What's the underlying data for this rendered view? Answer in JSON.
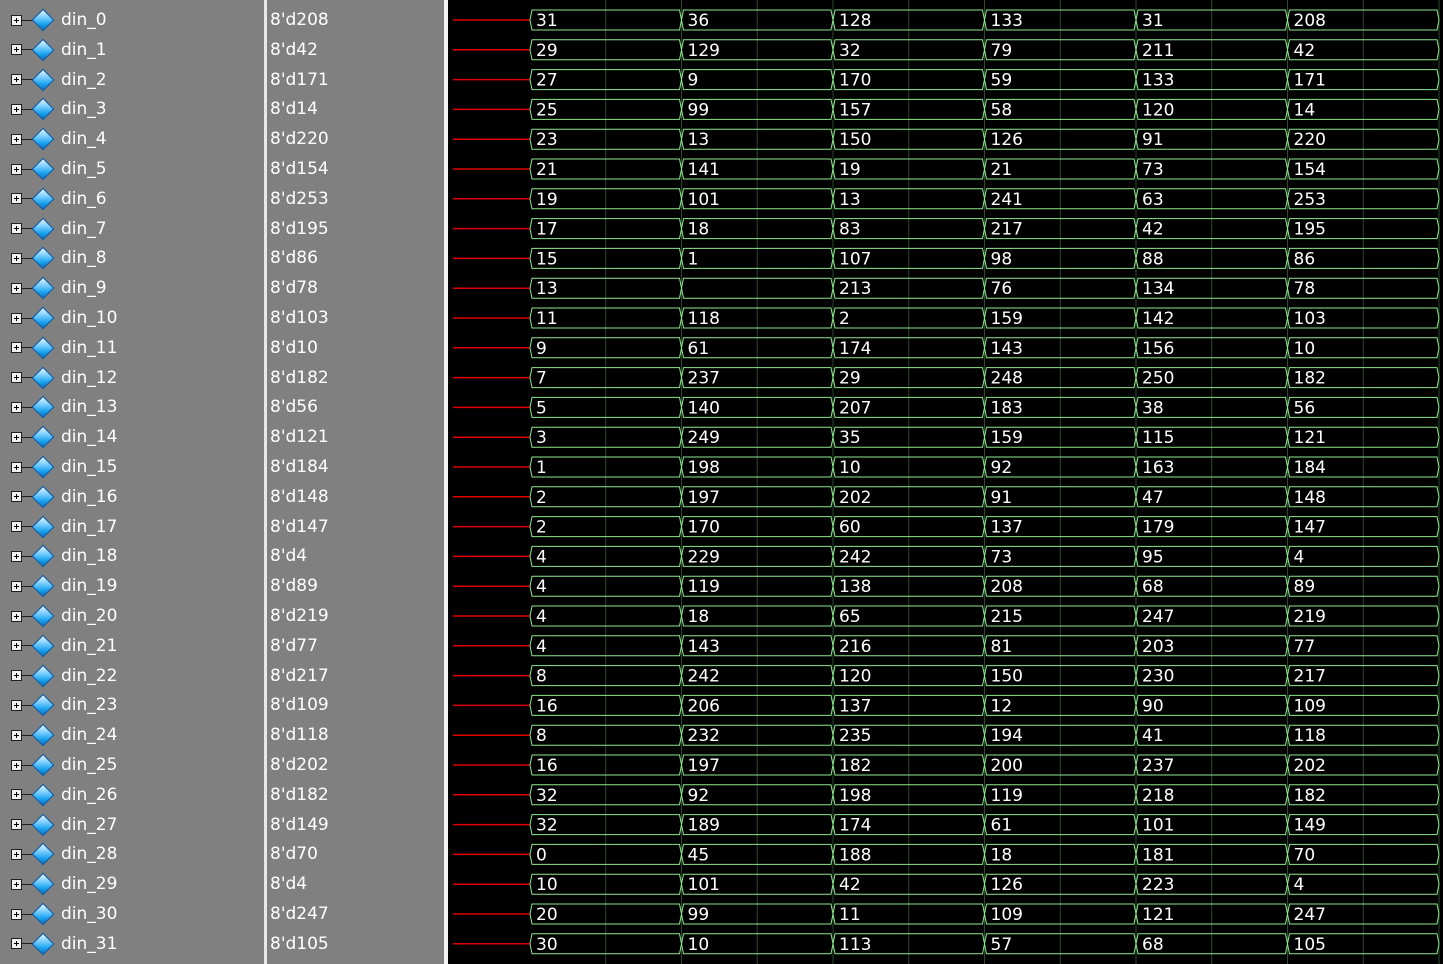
{
  "colors": {
    "pane_background": "#808080",
    "wave_background": "#000000",
    "bus_line": "#8ee88e",
    "undefined_line": "#e00000",
    "text": "#ffffff"
  },
  "icons": {
    "expand": "expand-plus-icon",
    "signal": "bus-diamond-icon"
  },
  "signals": [
    {
      "name": "din_0",
      "value": "8'd208",
      "wave": [
        "31",
        "36",
        "128",
        "133",
        "31",
        "208"
      ]
    },
    {
      "name": "din_1",
      "value": "8'd42",
      "wave": [
        "29",
        "129",
        "32",
        "79",
        "211",
        "42"
      ]
    },
    {
      "name": "din_2",
      "value": "8'd171",
      "wave": [
        "27",
        "9",
        "170",
        "59",
        "133",
        "171"
      ]
    },
    {
      "name": "din_3",
      "value": "8'd14",
      "wave": [
        "25",
        "99",
        "157",
        "58",
        "120",
        "14"
      ]
    },
    {
      "name": "din_4",
      "value": "8'd220",
      "wave": [
        "23",
        "13",
        "150",
        "126",
        "91",
        "220"
      ]
    },
    {
      "name": "din_5",
      "value": "8'd154",
      "wave": [
        "21",
        "141",
        "19",
        "21",
        "73",
        "154"
      ]
    },
    {
      "name": "din_6",
      "value": "8'd253",
      "wave": [
        "19",
        "101",
        "13",
        "241",
        "63",
        "253"
      ]
    },
    {
      "name": "din_7",
      "value": "8'd195",
      "wave": [
        "17",
        "18",
        "83",
        "217",
        "42",
        "195"
      ]
    },
    {
      "name": "din_8",
      "value": "8'd86",
      "wave": [
        "15",
        "1",
        "107",
        "98",
        "88",
        "86"
      ]
    },
    {
      "name": "din_9",
      "value": "8'd78",
      "wave": [
        "13",
        "",
        "213",
        "76",
        "134",
        "78"
      ]
    },
    {
      "name": "din_10",
      "value": "8'd103",
      "wave": [
        "11",
        "118",
        "2",
        "159",
        "142",
        "103"
      ]
    },
    {
      "name": "din_11",
      "value": "8'd10",
      "wave": [
        "9",
        "61",
        "174",
        "143",
        "156",
        "10"
      ]
    },
    {
      "name": "din_12",
      "value": "8'd182",
      "wave": [
        "7",
        "237",
        "29",
        "248",
        "250",
        "182"
      ]
    },
    {
      "name": "din_13",
      "value": "8'd56",
      "wave": [
        "5",
        "140",
        "207",
        "183",
        "38",
        "56"
      ]
    },
    {
      "name": "din_14",
      "value": "8'd121",
      "wave": [
        "3",
        "249",
        "35",
        "159",
        "115",
        "121"
      ]
    },
    {
      "name": "din_15",
      "value": "8'd184",
      "wave": [
        "1",
        "198",
        "10",
        "92",
        "163",
        "184"
      ]
    },
    {
      "name": "din_16",
      "value": "8'd148",
      "wave": [
        "2",
        "197",
        "202",
        "91",
        "47",
        "148"
      ]
    },
    {
      "name": "din_17",
      "value": "8'd147",
      "wave": [
        "2",
        "170",
        "60",
        "137",
        "179",
        "147"
      ]
    },
    {
      "name": "din_18",
      "value": "8'd4",
      "wave": [
        "4",
        "229",
        "242",
        "73",
        "95",
        "4"
      ]
    },
    {
      "name": "din_19",
      "value": "8'd89",
      "wave": [
        "4",
        "119",
        "138",
        "208",
        "68",
        "89"
      ]
    },
    {
      "name": "din_20",
      "value": "8'd219",
      "wave": [
        "4",
        "18",
        "65",
        "215",
        "247",
        "219"
      ]
    },
    {
      "name": "din_21",
      "value": "8'd77",
      "wave": [
        "4",
        "143",
        "216",
        "81",
        "203",
        "77"
      ]
    },
    {
      "name": "din_22",
      "value": "8'd217",
      "wave": [
        "8",
        "242",
        "120",
        "150",
        "230",
        "217"
      ]
    },
    {
      "name": "din_23",
      "value": "8'd109",
      "wave": [
        "16",
        "206",
        "137",
        "12",
        "90",
        "109"
      ]
    },
    {
      "name": "din_24",
      "value": "8'd118",
      "wave": [
        "8",
        "232",
        "235",
        "194",
        "41",
        "118"
      ]
    },
    {
      "name": "din_25",
      "value": "8'd202",
      "wave": [
        "16",
        "197",
        "182",
        "200",
        "237",
        "202"
      ]
    },
    {
      "name": "din_26",
      "value": "8'd182",
      "wave": [
        "32",
        "92",
        "198",
        "119",
        "218",
        "182"
      ]
    },
    {
      "name": "din_27",
      "value": "8'd149",
      "wave": [
        "32",
        "189",
        "174",
        "61",
        "101",
        "149"
      ]
    },
    {
      "name": "din_28",
      "value": "8'd70",
      "wave": [
        "0",
        "45",
        "188",
        "18",
        "181",
        "70"
      ]
    },
    {
      "name": "din_29",
      "value": "8'd4",
      "wave": [
        "10",
        "101",
        "42",
        "126",
        "223",
        "4"
      ]
    },
    {
      "name": "din_30",
      "value": "8'd247",
      "wave": [
        "20",
        "99",
        "11",
        "109",
        "121",
        "247"
      ]
    },
    {
      "name": "din_31",
      "value": "8'd105",
      "wave": [
        "30",
        "10",
        "113",
        "57",
        "68",
        "105"
      ]
    }
  ]
}
